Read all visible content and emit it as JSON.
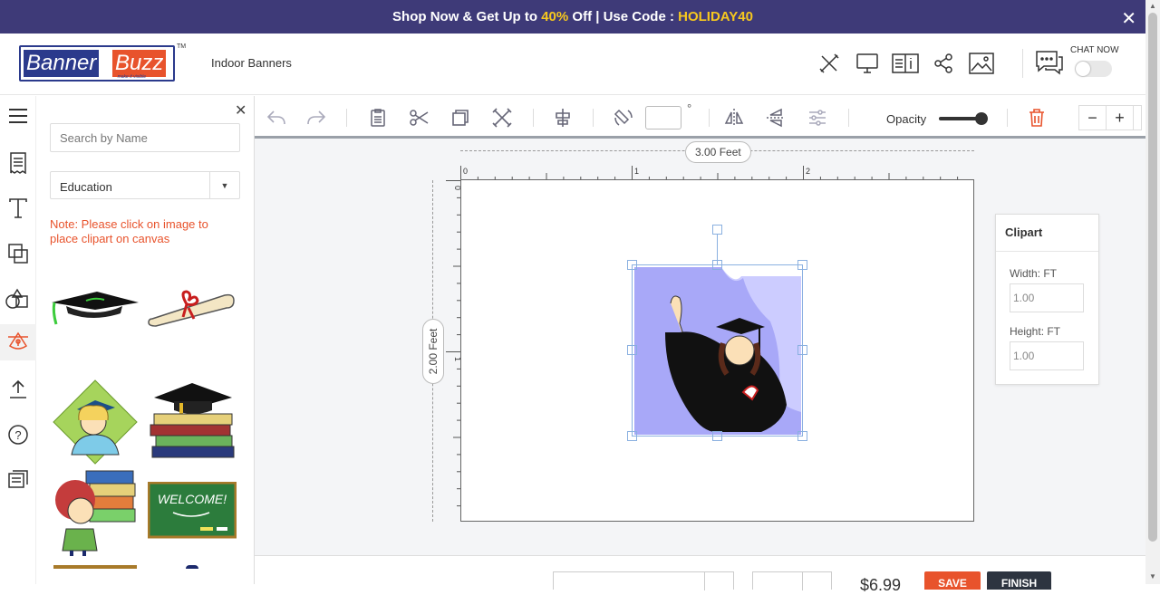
{
  "promo": {
    "text_pre": "Shop Now & Get Up to ",
    "percent": "40%",
    "text_mid": " Off | Use Code : ",
    "code": "HOLIDAY40",
    "close": "✕"
  },
  "header": {
    "logo_part1": "Banner",
    "logo_part2": "Buzz",
    "logo_tagline": "make it visible",
    "trademark": "TM",
    "product": "Indoor Banners",
    "icons": [
      "design-tools-icon",
      "desktop-preview-icon",
      "product-info-icon",
      "share-icon",
      "image-icon"
    ],
    "chat_label": "CHAT NOW"
  },
  "rail": {
    "items": [
      "menu-icon",
      "templates-icon",
      "text-icon",
      "background-icon",
      "shapes-icon",
      "clipart-icon",
      "upload-icon",
      "help-icon",
      "chat-icon"
    ],
    "active": "clipart-icon"
  },
  "panel": {
    "close": "✕",
    "search_placeholder": "Search by Name",
    "category": "Education",
    "note": "Note: Please click on image to place clipart on canvas",
    "cliparts": [
      "graduation-cap",
      "diploma-scroll",
      "graduate-girl",
      "books-with-cap",
      "girl-with-books",
      "welcome-chalkboard"
    ]
  },
  "toolbar": {
    "angle_value": "",
    "degree_symbol": "°",
    "opacity_label": "Opacity",
    "opacity_value": 1.0,
    "zoom_out": "−",
    "zoom_in": "+"
  },
  "canvas": {
    "width_label": "3.00 Feet",
    "height_label": "2.00 Feet",
    "h_ticks": [
      "0",
      "1",
      "2"
    ],
    "v_ticks": [
      "0",
      "1"
    ]
  },
  "properties": {
    "title": "Clipart",
    "width_label": "Width: FT",
    "width_value": "1.00",
    "height_label": "Height: FT",
    "height_value": "1.00"
  },
  "bottom": {
    "price": "$6.99",
    "save": "SAVE",
    "finish": "FINISH"
  },
  "colors": {
    "promo_bg": "#3e3a78",
    "highlight": "#f7c81e",
    "accent": "#e8532c",
    "brand_blue": "#2b3a8c"
  }
}
